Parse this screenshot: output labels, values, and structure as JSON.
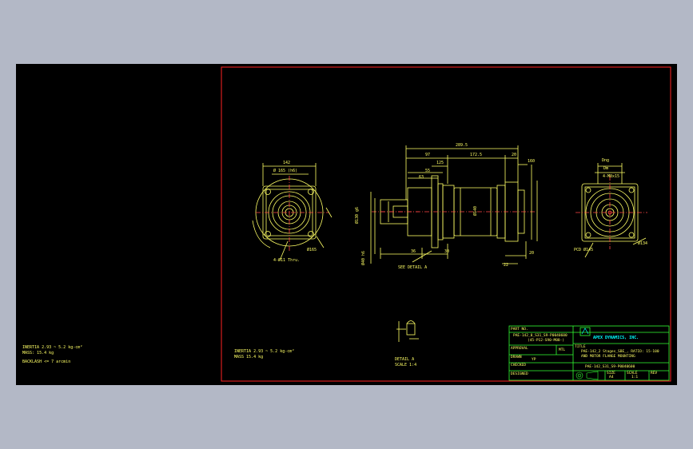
{
  "colors": {
    "page_background": "#b3b8c6",
    "model_space": "#000000",
    "frame": "#ff2222",
    "geometry": "#ffff66",
    "title_block": "#33ff33",
    "company": "#00ffff",
    "center_lines": "#ff4444"
  },
  "left_notes": {
    "inertia": "INERTIA 2.93 ~ 5.2 kg-cm²",
    "mass": "MASS: 15.4 kg",
    "backlash": "BACKLASH <= 7 arcmin"
  },
  "sheet_notes": {
    "inertia": "INERTIA 2.93 ~ 5.2 kg-cm²",
    "mass": "MASS 15.4 kg"
  },
  "front_view": {
    "dim_width": "142",
    "dim_pcd": "Ø 165 (h6)",
    "dim_bolt": "Ø165",
    "holes_note": "4-Ø11 Thru."
  },
  "side_view": {
    "overall": "289.5",
    "left_seg": "97",
    "mid_seg": "172.5",
    "right_seg": "20",
    "dim_a": "55",
    "dim_b": "63",
    "dim_c": "125",
    "dim_d": "160",
    "dim_e": "36",
    "dim_f": "30",
    "dim_g": "22",
    "dim_h": "20",
    "shaft_dia": "Ø130 g6",
    "key_dia": "Ø40 h6",
    "body_dia": "Ø140",
    "see_detail": "SEE DETAIL A"
  },
  "rear_view": {
    "dim_a": "Dng",
    "dim_b": "Dm",
    "holes": "4-M8x15",
    "pcd": "PCD Ø145",
    "side": "Ø134"
  },
  "detail": {
    "label": "DETAIL A",
    "scale": "SCALE 1:4"
  },
  "title_block": {
    "part_label": "PART NO.",
    "part_no": "PAE-142_0_S31_S9-P0040600",
    "part_no_2": "(45-P12-S90-M08-)",
    "company": "APEX DYNAMICS, INC.",
    "approval_label": "APPROVAL",
    "approval": "",
    "mtl_label": "MTL",
    "drawn_label": "DRAWN",
    "drawn": "YP",
    "check_label": "CHECKED",
    "design_label": "DESIGNED",
    "title_label": "TITLE",
    "title_1": "PAE-142_2 Stages_SBE_, RATIO: 15-100",
    "title_2": "AND MOTOR FLANGE MOUNTING",
    "drawing_no": "PAE-142_S31_S9-P0040600",
    "size_label": "SIZE",
    "size": "A4",
    "scale_label": "SCALE",
    "scale": "1:1",
    "rev_label": "REV"
  }
}
